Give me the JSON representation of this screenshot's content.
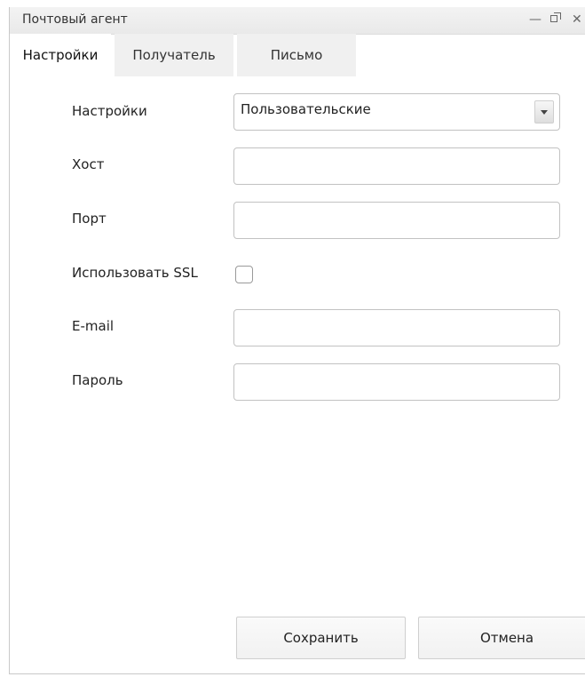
{
  "window": {
    "title": "Почтовый агент",
    "controls": {
      "minimize": "—"
    }
  },
  "tabs": [
    {
      "label": "Настройки",
      "active": true
    },
    {
      "label": "Получатель",
      "active": false
    },
    {
      "label": "Письмо",
      "active": false
    }
  ],
  "form": {
    "settings": {
      "label": "Настройки",
      "value": "Пользовательские"
    },
    "host": {
      "label": "Хост",
      "value": ""
    },
    "port": {
      "label": "Порт",
      "value": ""
    },
    "ssl": {
      "label": "Использовать SSL",
      "checked": false
    },
    "email": {
      "label": "E-mail",
      "value": ""
    },
    "password": {
      "label": "Пароль",
      "value": ""
    }
  },
  "buttons": {
    "save": "Сохранить",
    "cancel": "Отмена"
  },
  "icons": {
    "minimize": "minimize-icon",
    "restore": "restore-icon",
    "close": "close-icon",
    "dropdown": "chevron-down-icon"
  }
}
